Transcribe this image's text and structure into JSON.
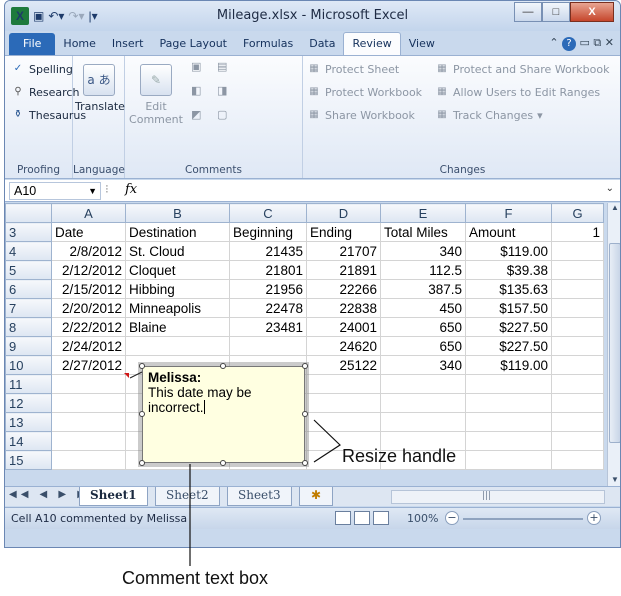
{
  "window": {
    "title": "Mileage.xlsx - Microsoft Excel"
  },
  "tabs": [
    "File",
    "Home",
    "Insert",
    "Page Layout",
    "Formulas",
    "Data",
    "Review",
    "View"
  ],
  "ribbon": {
    "proofing": {
      "label": "Proofing",
      "spelling": "Spelling",
      "research": "Research",
      "thesaurus": "Thesaurus"
    },
    "language": {
      "label": "Language",
      "translate": "Translate"
    },
    "comments": {
      "label": "Comments",
      "edit_comment_1": "Edit",
      "edit_comment_2": "Comment"
    },
    "changes": {
      "label": "Changes",
      "protect_sheet": "Protect Sheet",
      "protect_workbook": "Protect Workbook",
      "share_workbook": "Share Workbook",
      "protect_share": "Protect and Share Workbook",
      "allow_users": "Allow Users to Edit Ranges",
      "track_changes": "Track Changes"
    }
  },
  "formula_bar": {
    "name_box": "A10",
    "fx": "fx"
  },
  "columns": [
    "A",
    "B",
    "C",
    "D",
    "E",
    "F",
    "G"
  ],
  "rows": [
    {
      "n": "3",
      "cells": [
        "Date",
        "Destination",
        "Beginning",
        "Ending",
        "Total Miles",
        "Amount",
        "1"
      ]
    },
    {
      "n": "4",
      "cells": [
        "2/8/2012",
        "St. Cloud",
        "21435",
        "21707",
        "340",
        "$119.00",
        ""
      ]
    },
    {
      "n": "5",
      "cells": [
        "2/12/2012",
        "Cloquet",
        "21801",
        "21891",
        "112.5",
        "$39.38",
        ""
      ]
    },
    {
      "n": "6",
      "cells": [
        "2/15/2012",
        "Hibbing",
        "21956",
        "22266",
        "387.5",
        "$135.63",
        ""
      ]
    },
    {
      "n": "7",
      "cells": [
        "2/20/2012",
        "Minneapolis",
        "22478",
        "22838",
        "450",
        "$157.50",
        ""
      ]
    },
    {
      "n": "8",
      "cells": [
        "2/22/2012",
        "Blaine",
        "23481",
        "24001",
        "650",
        "$227.50",
        ""
      ]
    },
    {
      "n": "9",
      "cells": [
        "2/24/2012",
        "",
        "",
        "24620",
        "650",
        "$227.50",
        ""
      ]
    },
    {
      "n": "10",
      "cells": [
        "2/27/2012",
        "",
        "",
        "25122",
        "340",
        "$119.00",
        ""
      ]
    },
    {
      "n": "11",
      "cells": [
        "",
        "",
        "",
        "",
        "",
        "",
        ""
      ]
    },
    {
      "n": "12",
      "cells": [
        "",
        "",
        "",
        "",
        "",
        "",
        ""
      ]
    },
    {
      "n": "13",
      "cells": [
        "",
        "",
        "",
        "",
        "",
        "",
        ""
      ]
    },
    {
      "n": "14",
      "cells": [
        "",
        "",
        "",
        "",
        "",
        "",
        ""
      ]
    },
    {
      "n": "15",
      "cells": [
        "",
        "",
        "",
        "",
        "",
        "",
        ""
      ]
    }
  ],
  "comment": {
    "author": "Melissa:",
    "text": "This date may be incorrect."
  },
  "sheets": [
    "Sheet1",
    "Sheet2",
    "Sheet3"
  ],
  "status": {
    "text": "Cell A10 commented by Melissa",
    "zoom": "100%"
  },
  "callouts": {
    "resize": "Resize handle",
    "textbox": "Comment text box"
  }
}
